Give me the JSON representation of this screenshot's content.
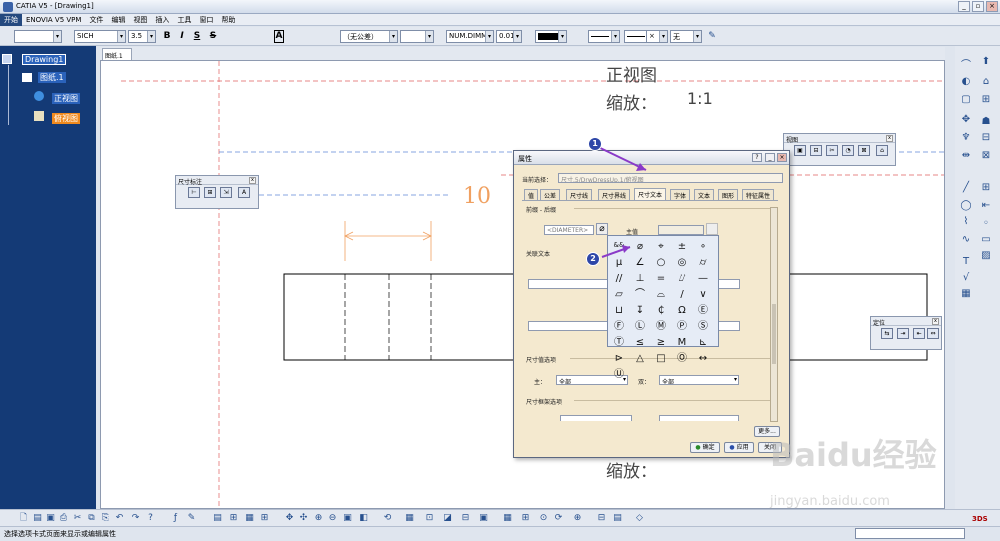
{
  "window": {
    "title": "CATIA V5 - [Drawing1]",
    "minimize": "_",
    "restore": "▫",
    "close": "×"
  },
  "menu": [
    "开始",
    "ENOVIA V5 VPM",
    "文件",
    "编辑",
    "视图",
    "插入",
    "工具",
    "窗口",
    "帮助"
  ],
  "toolbar": {
    "font": "SICH",
    "size": "3.5",
    "bold": "B",
    "italic": "I",
    "underline": "S",
    "strike": "S",
    "frame": "A",
    "tolerance": "（无公差）",
    "dimstyle": "NUM.DIMM",
    "precision": "0.010",
    "linestyle": "无"
  },
  "tree": {
    "root": "Drawing1",
    "sheet": "图纸.1",
    "view1": "正视图",
    "view2": "俯视图"
  },
  "canvas": {
    "tab": "图纸.1",
    "view_title": "正视图",
    "scale_label": "缩放：",
    "scale_value": "1:1",
    "scale_label_bottom": "缩放：",
    "dim_value": "10"
  },
  "floating": {
    "dim_toolbar": {
      "title": "尺寸标注",
      "close": "x"
    },
    "view_toolbar": {
      "title": "视图",
      "close": "x"
    },
    "position_toolbar": {
      "title": "定位",
      "close": "x"
    }
  },
  "dialog": {
    "title": "属性",
    "current_label": "当前选择：",
    "current_value": "尺寸.5/DrwDressUp.1/俯视图",
    "tabs": [
      "值",
      "公差",
      "尺寸线",
      "尺寸界线",
      "尺寸文本",
      "字体",
      "文本",
      "图形",
      "特征属性"
    ],
    "active_tab": "尺寸文本",
    "prefix_suffix_label": "前缀 - 后缀",
    "prefix_value": "<DIAMETER>",
    "main_value_label": "主值",
    "assoc_text_label": "关联文本",
    "dim_value_options_label": "尺寸值选项",
    "main_label": "主：",
    "main_select": "全部",
    "dual_label": "双：",
    "dual_select": "全部",
    "frame_options_label": "尺寸框架选项",
    "more_button": "更多...",
    "ok_button": "确定",
    "apply_button": "应用",
    "close_button": "关闭",
    "callout1": "1",
    "callout2": "2"
  },
  "symbols": [
    "⌀",
    "⌖",
    "±",
    "∘",
    "μ",
    "∠",
    "○",
    "◎",
    "⌭",
    "//",
    "⊥",
    "=",
    "⌰",
    "—",
    "⏥",
    "⌒",
    "⌓",
    "/",
    "∨",
    "⊔",
    "↧",
    "₵",
    "Ω",
    "Ⓔ",
    "Ⓕ",
    "Ⓛ",
    "Ⓜ",
    "Ⓟ",
    "Ⓢ",
    "Ⓣ",
    "≤",
    "≥",
    "M",
    "⊾",
    "⊳",
    "△",
    "□",
    "Ⓞ",
    "↔",
    "Ⓤ"
  ],
  "status": {
    "text": "选择选项卡式页面来显示或编辑属性"
  },
  "watermark": {
    "brand": "Baidu经验",
    "url": "jingyan.baidu.com"
  }
}
